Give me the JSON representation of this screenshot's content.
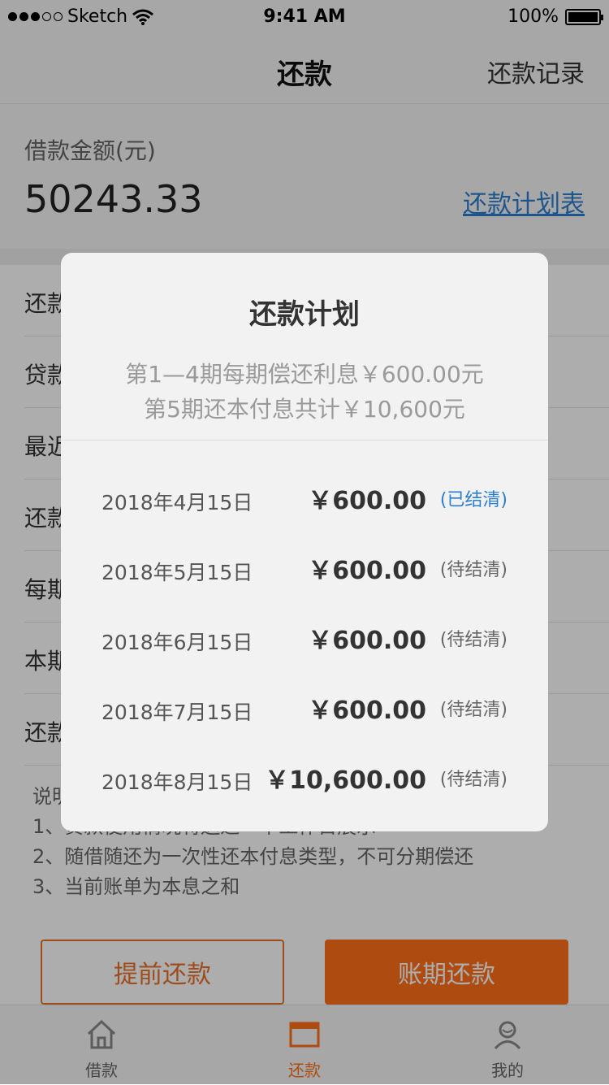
{
  "status_bar": {
    "carrier": "Sketch",
    "time": "9:41 AM",
    "battery": "100%"
  },
  "nav": {
    "title": "还款",
    "right_link": "还款记录"
  },
  "summary": {
    "label": "借款金额(元)",
    "amount": "50243.33",
    "plan_link": "还款计划表"
  },
  "rows": [
    {
      "label": "还款"
    },
    {
      "label": "贷款"
    },
    {
      "label": "最近"
    },
    {
      "label": "还款"
    },
    {
      "label": "每期"
    },
    {
      "label": "本期"
    },
    {
      "label": "还款"
    }
  ],
  "notes": {
    "heading": "说明",
    "line1": "1、贷款使用情况将送达一个工作日展示",
    "line2": "2、随借随还为一次性还本付息类型，不可分期偿还",
    "line3": "3、当前账单为本息之和"
  },
  "buttons": {
    "prepay": "提前还款",
    "period_pay": "账期还款"
  },
  "tabs": [
    {
      "label": "借款",
      "icon": "house-icon"
    },
    {
      "label": "还款",
      "icon": "bill-icon",
      "active": true
    },
    {
      "label": "我的",
      "icon": "user-icon"
    }
  ],
  "modal": {
    "title": "还款计划",
    "subtitle_line1": "第1—4期每期偿还利息￥600.00元",
    "subtitle_line2": "第5期还本付息共计￥10,600元",
    "payments": [
      {
        "date": "2018年4月15日",
        "amount": "￥600.00",
        "status": "(已结清)",
        "paid": true
      },
      {
        "date": "2018年5月15日",
        "amount": "￥600.00",
        "status": "(待结清)",
        "paid": false
      },
      {
        "date": "2018年6月15日",
        "amount": "￥600.00",
        "status": "(待结清)",
        "paid": false
      },
      {
        "date": "2018年7月15日",
        "amount": "￥600.00",
        "status": "(待结清)",
        "paid": false
      },
      {
        "date": "2018年8月15日",
        "amount": "￥10,600.00",
        "status": "(待结清)",
        "paid": false
      }
    ]
  },
  "colors": {
    "accent": "#ff6f1a",
    "link": "#2c7fd0"
  }
}
